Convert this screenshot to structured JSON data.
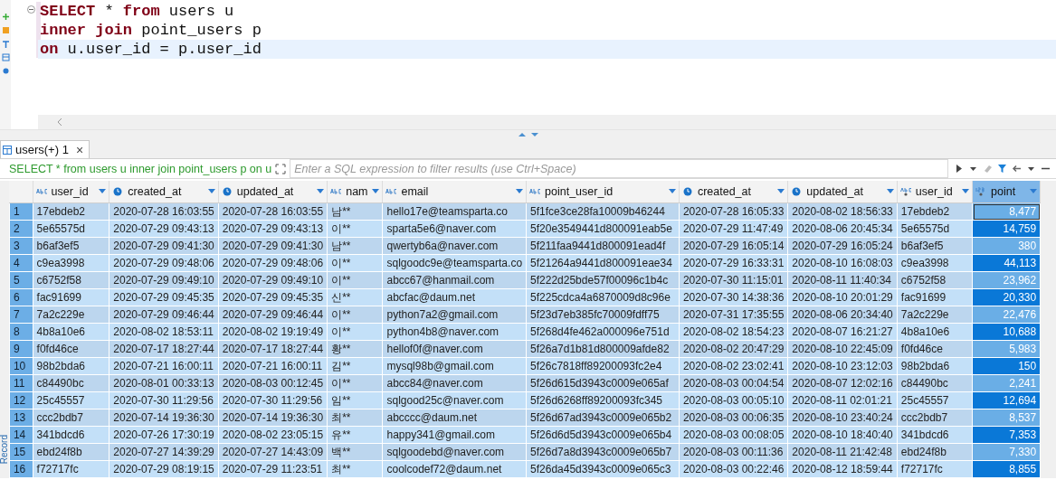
{
  "editor": {
    "lines": [
      {
        "current": false,
        "tokens": [
          {
            "kind": "keyword",
            "text": "SELECT"
          },
          {
            "kind": "plain",
            "text": " * "
          },
          {
            "kind": "keyword",
            "text": "from"
          },
          {
            "kind": "plain",
            "text": " users u"
          }
        ]
      },
      {
        "current": false,
        "tokens": [
          {
            "kind": "keyword",
            "text": "inner join"
          },
          {
            "kind": "plain",
            "text": " point_users p"
          }
        ]
      },
      {
        "current": true,
        "tokens": [
          {
            "kind": "keyword",
            "text": "on"
          },
          {
            "kind": "plain",
            "text": " u.user_id = p.user_id"
          }
        ]
      }
    ]
  },
  "results_tab": {
    "label": "users(+) 1",
    "close": "×"
  },
  "filter": {
    "query": "SELECT * from users u inner join point_users p on u",
    "placeholder": "Enter a SQL expression to filter results (use Ctrl+Space)"
  },
  "side_label": "Record",
  "table": {
    "columns": [
      {
        "label": "user_id",
        "kind": "text",
        "selected": false
      },
      {
        "label": "created_at",
        "kind": "date",
        "selected": false
      },
      {
        "label": "updated_at",
        "kind": "date",
        "selected": false
      },
      {
        "label": "nam",
        "kind": "text",
        "selected": false
      },
      {
        "label": "email",
        "kind": "text",
        "selected": false
      },
      {
        "label": "point_user_id",
        "kind": "text",
        "selected": false
      },
      {
        "label": "created_at",
        "kind": "date",
        "selected": false
      },
      {
        "label": "updated_at",
        "kind": "date",
        "selected": false
      },
      {
        "label": "user_id",
        "kind": "key",
        "selected": false
      },
      {
        "label": "point",
        "kind": "number",
        "selected": true
      }
    ],
    "rows": [
      {
        "number": "1",
        "selected": true,
        "focused": true,
        "cells": [
          "17ebdeb2",
          "2020-07-28 16:03:55",
          "2020-07-28 16:03:55",
          "남**",
          "hello17e@teamsparta.co",
          "5f1fce3ce28fa10009b46244",
          "2020-07-28 16:05:33",
          "2020-08-02 18:56:33",
          "17ebdeb2",
          "8,477"
        ]
      },
      {
        "number": "2",
        "selected": true,
        "focused": false,
        "cells": [
          "5e65575d",
          "2020-07-29 09:43:13",
          "2020-07-29 09:43:13",
          "이**",
          "sparta5e6@naver.com",
          "5f20e3549441d800091eab5e",
          "2020-07-29 11:47:49",
          "2020-08-06 20:45:34",
          "5e65575d",
          "14,759"
        ]
      },
      {
        "number": "3",
        "selected": true,
        "focused": false,
        "cells": [
          "b6af3ef5",
          "2020-07-29 09:41:30",
          "2020-07-29 09:41:30",
          "남**",
          "qwertyb6a@naver.com",
          "5f211faa9441d800091ead4f",
          "2020-07-29 16:05:14",
          "2020-07-29 16:05:24",
          "b6af3ef5",
          "380"
        ]
      },
      {
        "number": "4",
        "selected": true,
        "focused": false,
        "cells": [
          "c9ea3998",
          "2020-07-29 09:48:06",
          "2020-07-29 09:48:06",
          "이**",
          "sqlgoodc9e@teamsparta.co",
          "5f21264a9441d800091eae34",
          "2020-07-29 16:33:31",
          "2020-08-10 16:08:03",
          "c9ea3998",
          "44,113"
        ]
      },
      {
        "number": "5",
        "selected": true,
        "focused": false,
        "cells": [
          "c6752f58",
          "2020-07-29 09:49:10",
          "2020-07-29 09:49:10",
          "이**",
          "abcc67@hanmail.com",
          "5f222d25bde57f00096c1b4c",
          "2020-07-30 11:15:01",
          "2020-08-11 11:40:34",
          "c6752f58",
          "23,962"
        ]
      },
      {
        "number": "6",
        "selected": true,
        "focused": false,
        "cells": [
          "fac91699",
          "2020-07-29 09:45:35",
          "2020-07-29 09:45:35",
          "신**",
          "abcfac@daum.net",
          "5f225cdca4a6870009d8c96e",
          "2020-07-30 14:38:36",
          "2020-08-10 20:01:29",
          "fac91699",
          "20,330"
        ]
      },
      {
        "number": "7",
        "selected": true,
        "focused": false,
        "cells": [
          "7a2c229e",
          "2020-07-29 09:46:44",
          "2020-07-29 09:46:44",
          "이**",
          "python7a2@gmail.com",
          "5f23d7eb385fc70009fdff75",
          "2020-07-31 17:35:55",
          "2020-08-06 20:34:40",
          "7a2c229e",
          "22,476"
        ]
      },
      {
        "number": "8",
        "selected": true,
        "focused": false,
        "cells": [
          "4b8a10e6",
          "2020-08-02 18:53:11",
          "2020-08-02 19:19:49",
          "이**",
          "python4b8@naver.com",
          "5f268d4fe462a000096e751d",
          "2020-08-02 18:54:23",
          "2020-08-07 16:21:27",
          "4b8a10e6",
          "10,688"
        ]
      },
      {
        "number": "9",
        "selected": true,
        "focused": false,
        "cells": [
          "f0fd46ce",
          "2020-07-17 18:27:44",
          "2020-07-17 18:27:44",
          "황**",
          "hellof0f@naver.com",
          "5f26a7d1b81d800009afde82",
          "2020-08-02 20:47:29",
          "2020-08-10 22:45:09",
          "f0fd46ce",
          "5,983"
        ]
      },
      {
        "number": "10",
        "selected": true,
        "focused": false,
        "cells": [
          "98b2bda6",
          "2020-07-21 16:00:11",
          "2020-07-21 16:00:11",
          "김**",
          "mysql98b@gmail.com",
          "5f26c7818ff89200093fc2e4",
          "2020-08-02 23:02:41",
          "2020-08-10 23:12:03",
          "98b2bda6",
          "150"
        ]
      },
      {
        "number": "11",
        "selected": true,
        "focused": false,
        "cells": [
          "c84490bc",
          "2020-08-01 00:33:13",
          "2020-08-03 00:12:45",
          "이**",
          "abcc84@naver.com",
          "5f26d615d3943c0009e065af",
          "2020-08-03 00:04:54",
          "2020-08-07 12:02:16",
          "c84490bc",
          "2,241"
        ]
      },
      {
        "number": "12",
        "selected": true,
        "focused": false,
        "cells": [
          "25c45557",
          "2020-07-30 11:29:56",
          "2020-07-30 11:29:56",
          "임**",
          "sqlgood25c@naver.com",
          "5f26d6268ff89200093fc345",
          "2020-08-03 00:05:10",
          "2020-08-11 02:01:21",
          "25c45557",
          "12,694"
        ]
      },
      {
        "number": "13",
        "selected": true,
        "focused": false,
        "cells": [
          "ccc2bdb7",
          "2020-07-14 19:36:30",
          "2020-07-14 19:36:30",
          "최**",
          "abcccc@daum.net",
          "5f26d67ad3943c0009e065b2",
          "2020-08-03 00:06:35",
          "2020-08-10 23:40:24",
          "ccc2bdb7",
          "8,537"
        ]
      },
      {
        "number": "14",
        "selected": true,
        "focused": false,
        "cells": [
          "341bdcd6",
          "2020-07-26 17:30:19",
          "2020-08-02 23:05:15",
          "유**",
          "happy341@gmail.com",
          "5f26d6d5d3943c0009e065b4",
          "2020-08-03 00:08:05",
          "2020-08-10 18:40:40",
          "341bdcd6",
          "7,353"
        ]
      },
      {
        "number": "15",
        "selected": true,
        "focused": false,
        "cells": [
          "ebd24f8b",
          "2020-07-27 14:39:29",
          "2020-07-27 14:43:09",
          "백**",
          "sqlgoodebd@naver.com",
          "5f26d7a8d3943c0009e065b7",
          "2020-08-03 00:11:36",
          "2020-08-11 21:42:48",
          "ebd24f8b",
          "7,330"
        ]
      },
      {
        "number": "16",
        "selected": true,
        "focused": false,
        "cells": [
          "f72717fc",
          "2020-07-29 08:19:15",
          "2020-07-29 11:23:51",
          "최**",
          "coolcodef72@daum.net",
          "5f26da45d3943c0009e065c3",
          "2020-08-03 00:22:46",
          "2020-08-12 18:59:44",
          "f72717fc",
          "8,855"
        ]
      }
    ]
  }
}
